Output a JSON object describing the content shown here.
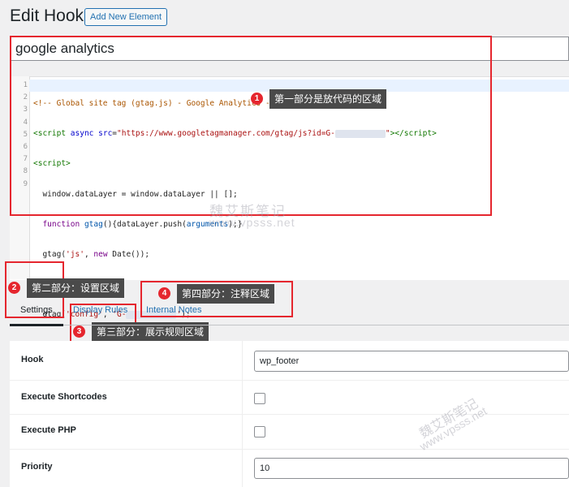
{
  "header": {
    "title": "Edit Hook",
    "add_new_label": "Add New Element"
  },
  "hook_name": "google analytics",
  "code": {
    "line_numbers": [
      "1",
      "2",
      "3",
      "4",
      "5",
      "6",
      "7",
      "8",
      "9"
    ]
  },
  "annotations": [
    {
      "number": "1",
      "text": "第一部分是放代码的区域"
    },
    {
      "number": "2",
      "text": "第二部分：设置区域"
    },
    {
      "number": "3",
      "text": "第三部分：展示规则区域"
    },
    {
      "number": "4",
      "text": "第四部分：注释区域"
    }
  ],
  "tabs": [
    {
      "label": "Settings",
      "active": true
    },
    {
      "label": "Display Rules",
      "active": false
    },
    {
      "label": "Internal Notes",
      "active": false
    }
  ],
  "settings": {
    "hook_label": "Hook",
    "hook_value": "wp_footer",
    "execute_shortcodes_label": "Execute Shortcodes",
    "execute_php_label": "Execute PHP",
    "priority_label": "Priority",
    "priority_value": "10"
  },
  "watermark": {
    "cn": "魏艾斯笔记",
    "url": "www.vpsss.net"
  },
  "colors": {
    "accent": "#2271b1",
    "annotation_red": "#e5262e",
    "tooltip_bg": "#4a4a4a"
  }
}
